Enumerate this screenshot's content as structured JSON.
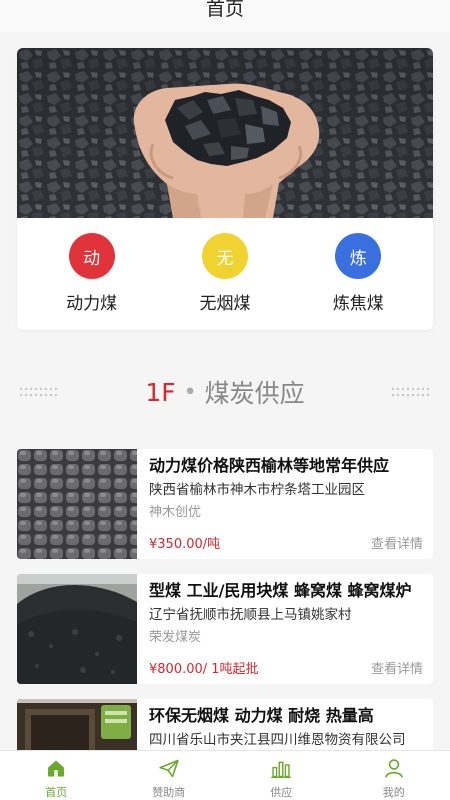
{
  "header": {
    "title": "首页"
  },
  "categories": [
    {
      "icon_char": "动",
      "label": "动力煤",
      "color": "#e0343a",
      "icon": "power-coal-icon"
    },
    {
      "icon_char": "无",
      "label": "无烟煤",
      "color": "#f0d330",
      "icon": "anthracite-icon"
    },
    {
      "icon_char": "炼",
      "label": "炼焦煤",
      "color": "#3a6fe0",
      "icon": "coking-coal-icon"
    }
  ],
  "section": {
    "floor": "1F",
    "separator": "•",
    "name": "煤炭供应"
  },
  "products": [
    {
      "title": "动力煤价格陕西榆林等地常年供应",
      "address": "陕西省榆林市神木市柠条塔工业园区",
      "company": "神木创优",
      "price": "¥350.00/吨",
      "detail": "查看详情"
    },
    {
      "title": "型煤 工业/民用块煤 蜂窝煤 蜂窝煤炉",
      "address": "辽宁省抚顺市抚顺县上马镇姚家村",
      "company": "荣发煤炭",
      "price": "¥800.00/ 1吨起批",
      "detail": "查看详情"
    },
    {
      "title": "环保无烟煤 动力煤 耐烧 热量高",
      "address": "四川省乐山市夹江县四川维恩物资有限公司",
      "company": "",
      "price": "",
      "detail": ""
    }
  ],
  "tabbar": {
    "items": [
      {
        "label": "首页",
        "icon": "home-icon",
        "active": true
      },
      {
        "label": "赞助商",
        "icon": "paper-plane-icon",
        "active": false
      },
      {
        "label": "供应",
        "icon": "bar-chart-icon",
        "active": false
      },
      {
        "label": "我的",
        "icon": "user-icon",
        "active": false
      }
    ],
    "active_color": "#6aaa2a",
    "inactive_color": "#888888"
  }
}
